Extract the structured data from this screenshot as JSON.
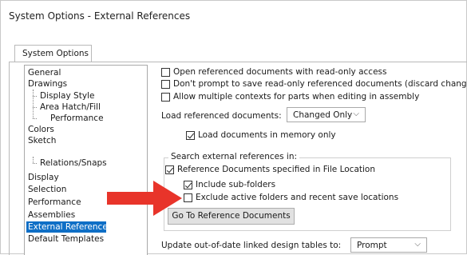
{
  "window": {
    "title": "System Options - External References"
  },
  "tabs": [
    {
      "label": "System Options"
    }
  ],
  "tree": {
    "items": [
      {
        "label": "General",
        "level": 0,
        "selected": false
      },
      {
        "label": "Drawings",
        "level": 0,
        "selected": false
      },
      {
        "label": "Display Style",
        "level": 1,
        "selected": false
      },
      {
        "label": "Area Hatch/Fill",
        "level": 1,
        "selected": false
      },
      {
        "label": "Performance",
        "level": 1,
        "selected": false
      },
      {
        "label": "Colors",
        "level": 0,
        "selected": false
      },
      {
        "label": "Sketch",
        "level": 0,
        "selected": false
      },
      {
        "label": "Relations/Snaps",
        "level": 1,
        "selected": false
      },
      {
        "label": "Display",
        "level": 0,
        "selected": false
      },
      {
        "label": "Selection",
        "level": 0,
        "selected": false
      },
      {
        "label": "Performance",
        "level": 0,
        "selected": false
      },
      {
        "label": "Assemblies",
        "level": 0,
        "selected": false
      },
      {
        "label": "External References",
        "level": 0,
        "selected": true
      },
      {
        "label": "Default Templates",
        "level": 0,
        "selected": false
      }
    ]
  },
  "options": {
    "open_readonly": {
      "label": "Open referenced documents with read-only access",
      "checked": false
    },
    "dont_prompt_save": {
      "label": "Don't prompt to save read-only referenced documents (discard changes)",
      "checked": false
    },
    "allow_multiple_contexts": {
      "label": "Allow multiple contexts for parts when editing in assembly",
      "checked": false
    },
    "load_referenced": {
      "label": "Load referenced documents:",
      "value": "Changed Only"
    },
    "load_in_memory": {
      "label": "Load documents in memory only",
      "checked": true
    },
    "search_group_label": "Search external references in:",
    "reference_docs": {
      "label": "Reference Documents specified in File Location",
      "checked": true
    },
    "include_subfolders": {
      "label": "Include sub-folders",
      "checked": true
    },
    "exclude_active": {
      "label": "Exclude active folders and recent save locations",
      "checked": false
    },
    "go_to_button": "Go To Reference Documents",
    "update_design_tables": {
      "label": "Update out-of-date linked design tables to:",
      "value": "Prompt"
    }
  },
  "colors": {
    "selection": "#0f6fc6",
    "arrow": "#e8342a"
  },
  "icons": {
    "dropdown": "chevron-down-icon",
    "annotation": "red-arrow-icon"
  }
}
